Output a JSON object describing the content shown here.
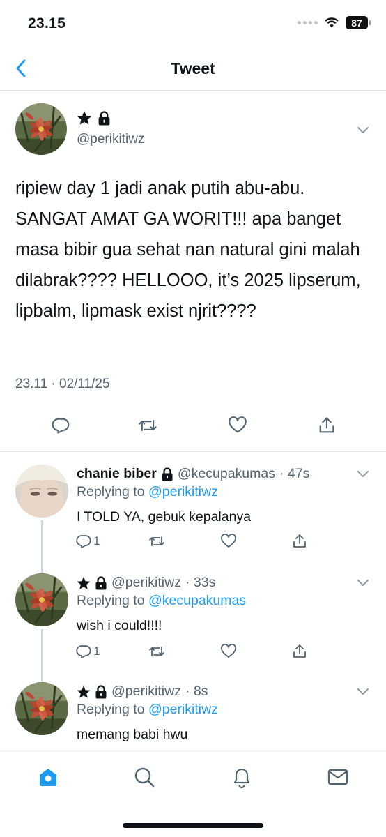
{
  "status": {
    "time": "23.15",
    "battery": "87"
  },
  "nav": {
    "title": "Tweet"
  },
  "main_tweet": {
    "handle": "@perikitiwz",
    "text": "ripiew day 1 jadi anak putih abu-abu. SANGAT AMAT GA WORIT!!! apa banget masa bibir gua sehat nan natural gini malah dilabrak???? HELLOOO, it’s 2025 lipserum, lipbalm, lipmask exist njrit????",
    "timestamp": "23.11 · 02/11/25"
  },
  "replies": [
    {
      "name": "chanie biber",
      "handle": "@kecupakumas",
      "age": "· 47s",
      "replying_label": "Replying to",
      "replying_to": "@perikitiwz",
      "text": "I TOLD YA, gebuk kepalanya",
      "reply_count": "1"
    },
    {
      "name": "",
      "handle": "@perikitiwz",
      "age": "· 33s",
      "replying_label": "Replying to",
      "replying_to": "@kecupakumas",
      "text": "wish i could!!!!",
      "reply_count": "1"
    },
    {
      "name": "",
      "handle": "@perikitiwz",
      "age": "· 8s",
      "replying_label": "Replying to",
      "replying_to": "@perikitiwz",
      "text": "memang babi hwu",
      "reply_count": ""
    }
  ],
  "icons": {
    "back": "chevron-left-icon",
    "reply": "reply-icon",
    "retweet": "retweet-icon",
    "like": "heart-icon",
    "share": "share-icon",
    "home": "home-icon",
    "search": "search-icon",
    "notifications": "bell-icon",
    "messages": "mail-icon"
  },
  "colors": {
    "accent": "#1d9bf0",
    "text": "#0f1419",
    "muted": "#536471"
  }
}
